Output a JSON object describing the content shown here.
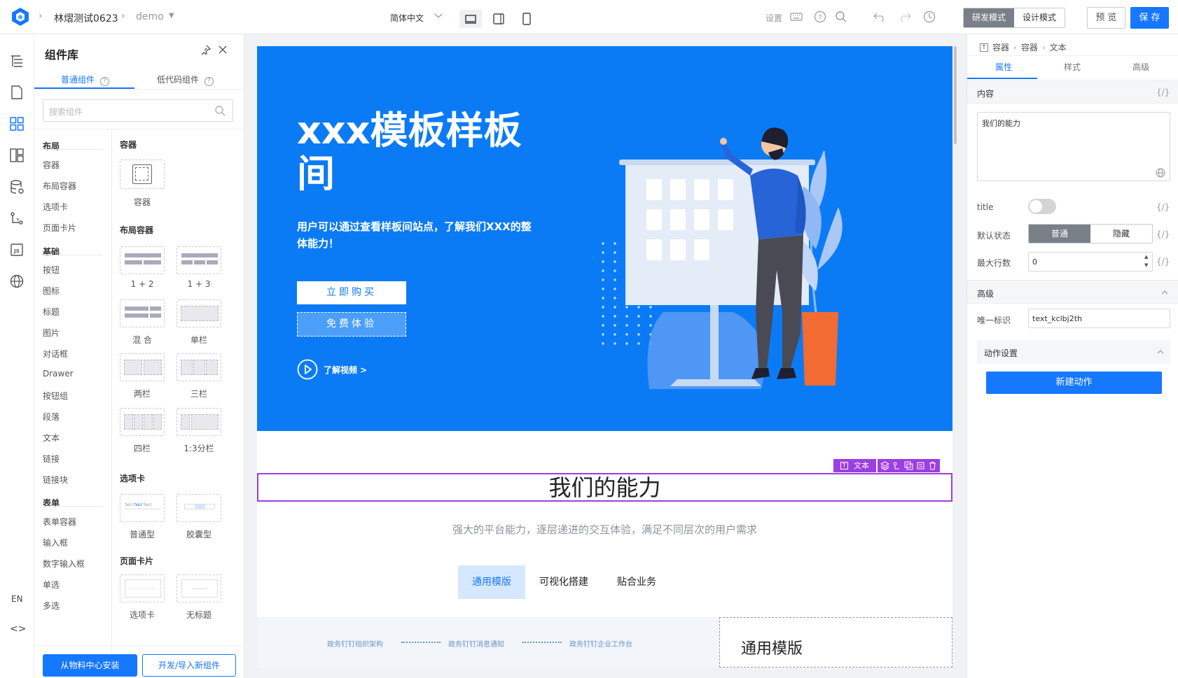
{
  "topbar": {
    "breadcrumb_project": "林熠测试0623",
    "breadcrumb_page": "demo",
    "language": "简体中文",
    "settings": "设置",
    "mode_dev": "研发模式",
    "mode_design": "设计模式",
    "preview": "预 览",
    "save": "保 存"
  },
  "rail": {
    "lang": "EN"
  },
  "library": {
    "title": "组件库",
    "tab_common": "普通组件",
    "tab_lowcode": "低代码组件",
    "search_placeholder": "搜索组件",
    "categories": {
      "layout": "布局",
      "layout_items": [
        "容器",
        "布局容器",
        "选项卡",
        "页面卡片"
      ],
      "basic": "基础",
      "basic_items": [
        "按钮",
        "图标",
        "标题",
        "图片",
        "对话框",
        "Drawer",
        "按钮组",
        "段落",
        "文本",
        "链接",
        "链接块"
      ],
      "form": "表单",
      "form_items": [
        "表单容器",
        "输入框",
        "数字输入框",
        "单选",
        "多选"
      ]
    },
    "sections": {
      "container": "容器",
      "container_item": "容器",
      "layout_container": "布局容器",
      "layout_items": [
        "1 + 2",
        "1 + 3",
        "混 合",
        "单栏",
        "两栏",
        "三栏",
        "四栏",
        "1:3分栏"
      ],
      "tabs": "选项卡",
      "tabs_items": [
        "普通型",
        "胶囊型"
      ],
      "page_card": "页面卡片",
      "page_card_items": [
        "选项卡",
        "无标题"
      ]
    },
    "btn_install": "从物料中心安装",
    "btn_import": "开发/导入新组件"
  },
  "canvas": {
    "hero_title": "xxx模板样板间",
    "hero_sub": "用户可以通过查看样板间站点，了解我们XXX的整体能力！",
    "buy": "立即购买",
    "trial": "免费体验",
    "video": "了解视频 >",
    "ability": "我们的能力",
    "ability_sub": "强大的平台能力，逐层递进的交互体验，满足不同层次的用户需求",
    "tabs": [
      "通用模版",
      "可视化搭建",
      "贴合业务"
    ],
    "flow": [
      "政务钉钉组织架构",
      "政务钉钉消息通知",
      "政务钉钉企业工作台"
    ],
    "card_title": "通用模版",
    "selection_label": "文本"
  },
  "panel": {
    "breadcrumb": [
      "容器",
      "容器",
      "文本"
    ],
    "tabs": [
      "属性",
      "样式",
      "高级"
    ],
    "content_label": "内容",
    "content_value": "我们的能力",
    "title_label": "title",
    "default_state_label": "默认状态",
    "state_normal": "普通",
    "state_hidden": "隐藏",
    "max_rows_label": "最大行数",
    "max_rows_value": "0",
    "advanced_label": "高级",
    "unique_id_label": "唯一标识",
    "unique_id_value": "text_kclbj2th",
    "action_settings": "动作设置",
    "new_action": "新建动作",
    "expr": "{/}"
  },
  "colors": {
    "primary": "#1677ff",
    "hero_bg": "#0b7bf5",
    "selection": "#9b3fe0"
  }
}
